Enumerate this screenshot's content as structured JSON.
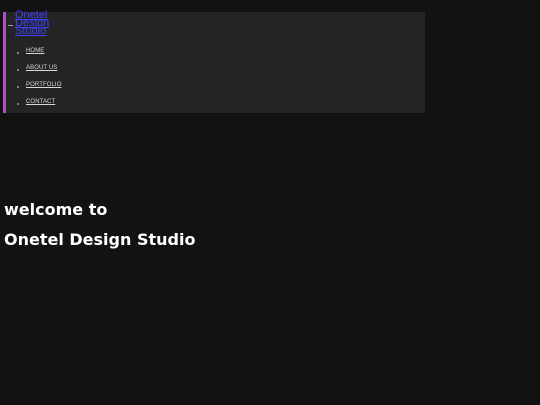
{
  "header": {
    "logo_alt_text": "Onetel Design Studio"
  },
  "nav": {
    "items": [
      {
        "label": "HOME"
      },
      {
        "label": "ABOUT US"
      },
      {
        "label": "PORTFOLIO"
      },
      {
        "label": "CONTACT"
      }
    ]
  },
  "hero": {
    "line1": "welcome to",
    "line2": "Onetel Design Studio"
  },
  "colors": {
    "background": "#121212",
    "panel": "#242424",
    "accent_border": "#b050c8",
    "link": "#4040ff",
    "hero_text": "#ffffff"
  }
}
